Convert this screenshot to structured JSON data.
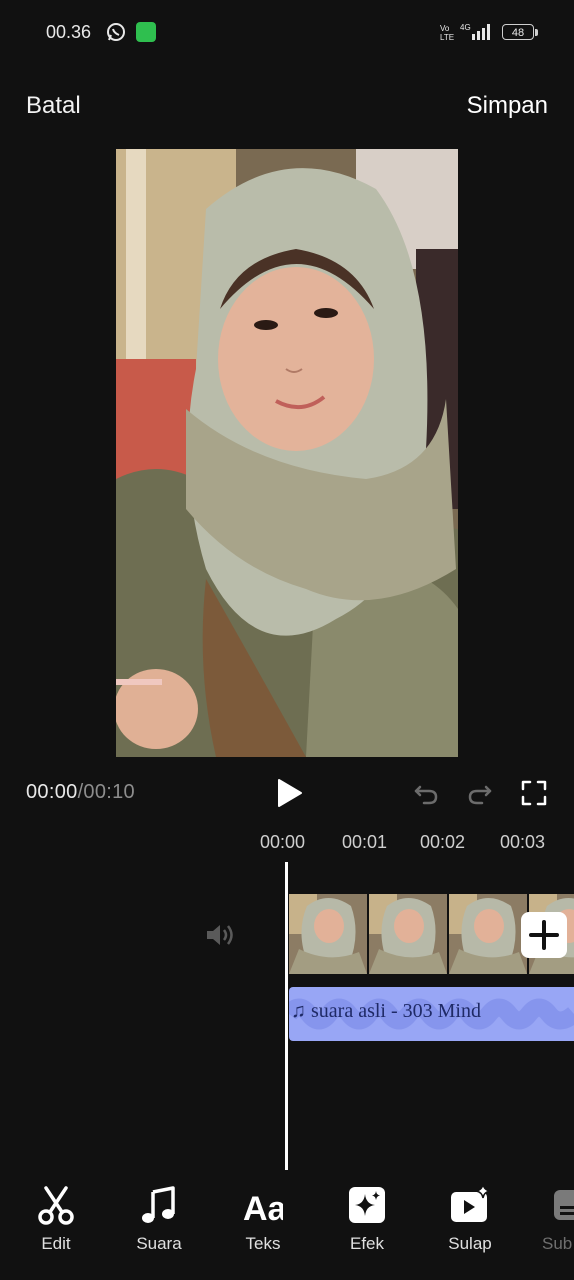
{
  "status_bar": {
    "time": "00.36",
    "battery": "48"
  },
  "header": {
    "cancel_label": "Batal",
    "save_label": "Simpan"
  },
  "player": {
    "current_time": "00:00",
    "separator": "/",
    "total_time": "00:10"
  },
  "timeline": {
    "ticks": [
      "00:00",
      "00:01",
      "00:02",
      "00:03"
    ],
    "audio_track_label": "♫ suara asli - 303 Mind"
  },
  "toolbar": {
    "items": [
      {
        "label": "Edit",
        "icon": "scissors-icon"
      },
      {
        "label": "Suara",
        "icon": "music-note-icon"
      },
      {
        "label": "Teks",
        "icon": "text-aa-icon"
      },
      {
        "label": "Efek",
        "icon": "sparkle-effect-icon"
      },
      {
        "label": "Sulap",
        "icon": "magic-video-icon"
      },
      {
        "label": "Sub",
        "icon": "subtitle-icon"
      }
    ]
  },
  "colors": {
    "background": "#111111",
    "audio_track": "#98a6f5",
    "audio_text": "#1f2a66"
  }
}
